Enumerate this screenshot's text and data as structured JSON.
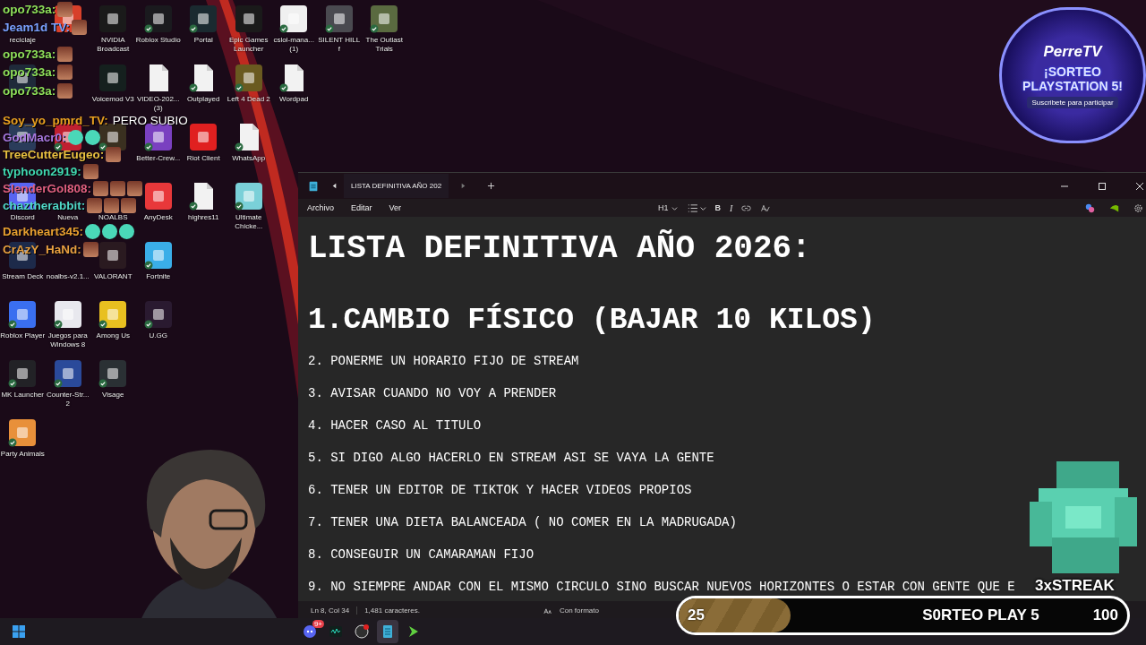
{
  "desktop": {
    "columns": [
      {
        "icons": [
          {
            "label": "reciclaje",
            "kind": "covered"
          },
          {
            "kind": "tile",
            "color": "#1f2a3a",
            "synced": false
          },
          {
            "kind": "tile",
            "color": "#2a3c5a",
            "synced": false
          },
          {
            "label": "Discord",
            "kind": "tile",
            "color": "#5865f2",
            "synced": false
          },
          {
            "label": "Stream Deck",
            "kind": "tile",
            "color": "#1d2a4a",
            "synced": false
          },
          {
            "label": "Roblox Player",
            "kind": "tile",
            "color": "#3a6ff0",
            "synced": true
          },
          {
            "label": "MK Launcher",
            "kind": "tile",
            "color": "#222226",
            "synced": true
          },
          {
            "label": "Party Animals",
            "kind": "tile",
            "color": "#e8903a",
            "synced": true
          }
        ]
      },
      {
        "icons": [
          {
            "kind": "tile",
            "color": "#d8402a",
            "synced": false
          },
          {
            "kind": "covered"
          },
          {
            "kind": "tile",
            "color": "#c02030",
            "synced": true
          },
          {
            "label": "Nueva",
            "kind": "covered"
          },
          {
            "label": "noalbs-v2.1...",
            "kind": "covered"
          },
          {
            "label": "Juegos para Windows 8",
            "kind": "tile",
            "color": "#e8e8ee",
            "synced": true
          },
          {
            "label": "Counter-Str... 2",
            "kind": "tile",
            "color": "#2a4a9a",
            "synced": true
          }
        ]
      },
      {
        "icons": [
          {
            "label": "NVIDIA Broadcast",
            "kind": "tile",
            "color": "#1a1a1a",
            "synced": false
          },
          {
            "label": "Voicemod V3",
            "kind": "tile",
            "color": "#15201e",
            "synced": false
          },
          {
            "kind": "tile",
            "color": "#3a3020",
            "synced": true
          },
          {
            "label": "NOALBS",
            "kind": "covered"
          },
          {
            "label": "VALORANT",
            "kind": "tile",
            "color": "#2a1a20",
            "synced": false
          },
          {
            "label": "Among Us",
            "kind": "tile",
            "color": "#e8c020",
            "synced": true
          },
          {
            "label": "Visage",
            "kind": "tile",
            "color": "#2a3034",
            "synced": true
          }
        ]
      },
      {
        "icons": [
          {
            "label": "Roblox Studio",
            "kind": "tile",
            "color": "#1a1a1e",
            "synced": true
          },
          {
            "label": "VIDEO-202... (3)",
            "kind": "doc",
            "color": "#f2f2f2",
            "synced": false
          },
          {
            "label": "Better-Crew...",
            "kind": "tile",
            "color": "#7a40c0",
            "synced": true
          },
          {
            "label": "AnyDesk",
            "kind": "tile",
            "color": "#e8383a",
            "synced": false
          },
          {
            "label": "Fortnite",
            "kind": "tile",
            "color": "#3aaee8",
            "synced": true
          },
          {
            "label": "U.GG",
            "kind": "tile",
            "color": "#2a1a30",
            "synced": true
          }
        ]
      },
      {
        "icons": [
          {
            "label": "Portal",
            "kind": "tile",
            "color": "#1a2a30",
            "synced": true
          },
          {
            "label": "Outplayed",
            "kind": "doc",
            "color": "#f2f2f2",
            "synced": true
          },
          {
            "label": "Riot Client",
            "kind": "tile",
            "color": "#e02020",
            "synced": false
          },
          {
            "label": "highres11",
            "kind": "doc",
            "color": "#f2f2f2",
            "synced": true
          }
        ]
      },
      {
        "icons": [
          {
            "label": "Epic Games Launcher",
            "kind": "tile",
            "color": "#1a1a1a",
            "synced": false
          },
          {
            "label": "Left 4 Dead 2",
            "kind": "tile",
            "color": "#6a5a20",
            "synced": true
          },
          {
            "label": "WhatsApp",
            "kind": "doc",
            "color": "#f2f2f2",
            "synced": true
          },
          {
            "label": "Ultimate Chicke...",
            "kind": "tile",
            "color": "#7ad0d8",
            "synced": true
          }
        ]
      },
      {
        "icons": [
          {
            "label": "cslol-mana... (1)",
            "kind": "tile",
            "color": "#f0f0f0",
            "synced": true
          },
          {
            "label": "Wordpad",
            "kind": "doc",
            "color": "#f2f2f2",
            "synced": true
          }
        ]
      },
      {
        "icons": [
          {
            "label": "SILENT HILL f",
            "kind": "tile",
            "color": "#4a4a50",
            "synced": true
          }
        ]
      },
      {
        "icons": [
          {
            "label": "The Outlast Trials",
            "kind": "tile",
            "color": "#5a6a40",
            "synced": true
          }
        ]
      }
    ]
  },
  "chat": [
    {
      "user": "opo733a:",
      "color": "#8fe05a"
    },
    {
      "user": "Jeam1d TV:",
      "color": "#7aa0ff"
    },
    {
      "user": "opo733a:",
      "color": "#8fe05a"
    },
    {
      "user": "opo733a:",
      "color": "#8fe05a"
    },
    {
      "user": "opo733a:",
      "color": "#8fe05a"
    },
    {
      "user": "Soy_yo_pmrd_TV:",
      "color": "#e8a020",
      "text": "PERO SUBIO"
    },
    {
      "user": "GodMacr0:",
      "color": "#a878e0",
      "emotes": [
        {
          "kind": "blob"
        },
        {
          "kind": "blob"
        }
      ]
    },
    {
      "user": "TreeCutterEugeo:",
      "color": "#e8c040"
    },
    {
      "user": "typhoon2919:",
      "color": "#40d8b0"
    },
    {
      "user": "SlenderGol808:",
      "color": "#e06080"
    },
    {
      "user": "chaztherabbit:",
      "color": "#50d8c8"
    },
    {
      "user": "Darkheart345:",
      "color": "#e8a030",
      "emotes": [
        {
          "kind": "blob"
        },
        {
          "kind": "blob"
        },
        {
          "kind": "blob"
        }
      ]
    },
    {
      "user": "CrAzY_HaNd:",
      "color": "#e8a040"
    }
  ],
  "badge": {
    "brand": "PerreTV",
    "title": "¡SORTEO PLAYSTATION 5!",
    "subtitle": "Suscribete para participar"
  },
  "notepad": {
    "tab": "LISTA DEFINITIVA AÑO 202",
    "menu": [
      "Archivo",
      "Editar",
      "Ver"
    ],
    "toolbar": [
      {
        "kind": "heading",
        "label": "H1"
      },
      {
        "kind": "list"
      },
      {
        "kind": "bold",
        "label": "B"
      },
      {
        "kind": "italic",
        "label": "I"
      },
      {
        "kind": "link"
      },
      {
        "kind": "spell"
      }
    ],
    "lines": [
      {
        "kind": "h1",
        "text": "LISTA DEFINITIVA AÑO 2026:"
      },
      {
        "kind": "h1",
        "text": "1.CAMBIO FÍSICO (BAJAR 10 KILOS)"
      },
      {
        "kind": "p",
        "text": "2. PONERME UN HORARIO FIJO DE STREAM"
      },
      {
        "kind": "p",
        "text": "3. AVISAR CUANDO NO VOY A PRENDER"
      },
      {
        "kind": "p",
        "text": "4. HACER CASO AL TITULO"
      },
      {
        "kind": "p",
        "text": "5. SI DIGO ALGO HACERLO EN STREAM ASI SE VAYA LA GENTE"
      },
      {
        "kind": "p",
        "text": "6. TENER UN EDITOR DE TIKTOK Y HACER VIDEOS PROPIOS"
      },
      {
        "kind": "p",
        "text": "7. TENER UNA DIETA BALANCEADA ( NO COMER EN LA MADRUGADA)"
      },
      {
        "kind": "p",
        "text": "8. CONSEGUIR UN CAMARAMAN FIJO"
      },
      {
        "kind": "p",
        "text": "9. NO SIEMPRE ANDAR CON EL MISMO CIRCULO SINO BUSCAR NUEVOS HORIZONTES O ESTAR CON GENTE QUE E"
      }
    ],
    "status": {
      "position": "Ln 8, Col 34",
      "count": "1,481 caracteres.",
      "format": "Con formato"
    }
  },
  "streak": {
    "label": "3xSTREAK"
  },
  "goal": {
    "current": "25",
    "title": "S0RTEO PLAY 5",
    "target": "100",
    "level": 0.25
  },
  "taskbar": {
    "apps": [
      {
        "kind": "discord",
        "badge": "9+",
        "active": false
      },
      {
        "kind": "voicemod",
        "active": false
      },
      {
        "kind": "obs",
        "active": false
      },
      {
        "kind": "notepad",
        "active": true
      },
      {
        "kind": "arrow",
        "active": false
      }
    ]
  }
}
